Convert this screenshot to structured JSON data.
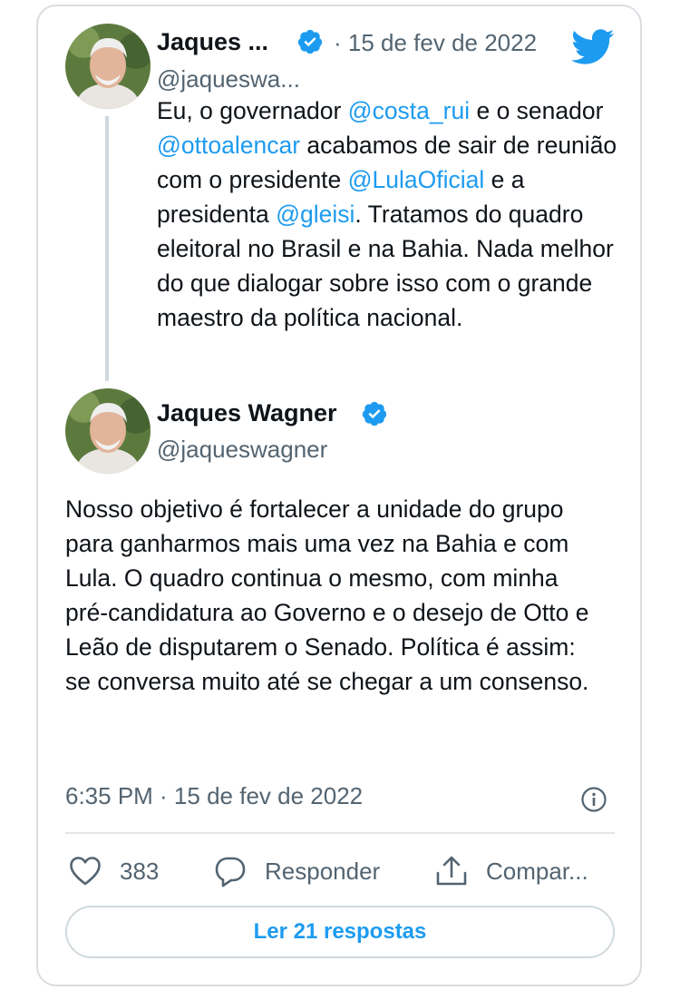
{
  "quoted_tweet": {
    "author_name": "Jaques ...",
    "author_handle": "@jaqueswa...",
    "date": "· 15 de fev de 2022",
    "text_segments": [
      {
        "text": "Eu, o governador ",
        "type": "text"
      },
      {
        "text": "@costa_rui",
        "type": "mention"
      },
      {
        "text": " e o senador ",
        "type": "text"
      },
      {
        "text": "@ottoalencar",
        "type": "mention"
      },
      {
        "text": " acabamos de sair de reunião com o presidente ",
        "type": "text"
      },
      {
        "text": "@LulaOficial",
        "type": "mention"
      },
      {
        "text": " e a presidenta ",
        "type": "text"
      },
      {
        "text": "@gleisi",
        "type": "mention"
      },
      {
        "text": ". Tratamos do quadro eleitoral no Brasil e na Bahia. Nada melhor do que dialogar sobre isso com o grande maestro da política nacional.",
        "type": "text"
      }
    ]
  },
  "main_tweet": {
    "author_name": "Jaques Wagner",
    "author_handle": "@jaqueswagner",
    "text": "Nosso objetivo é fortalecer a unidade do grupo para ganharmos mais uma vez na Bahia e com Lula. O quadro continua o mesmo, com minha pré-candidatura ao Governo e o desejo de Otto e Leão de disputarem o Senado. Política é assim: se conversa muito até se chegar a um consenso.",
    "timestamp": "6:35 PM · 15 de fev de 2022"
  },
  "actions": {
    "like_count": "383",
    "reply_label": "Responder",
    "share_label": "Compar..."
  },
  "read_replies_label": "Ler 21 respostas",
  "icons": {
    "brand": "twitter-bird-icon",
    "verified": "verified-badge-icon",
    "like": "heart-icon",
    "reply": "speech-bubble-icon",
    "share": "share-icon",
    "info": "info-icon"
  },
  "colors": {
    "accent": "#1d9bf0",
    "text": "#0f1419",
    "secondary": "#536471"
  }
}
